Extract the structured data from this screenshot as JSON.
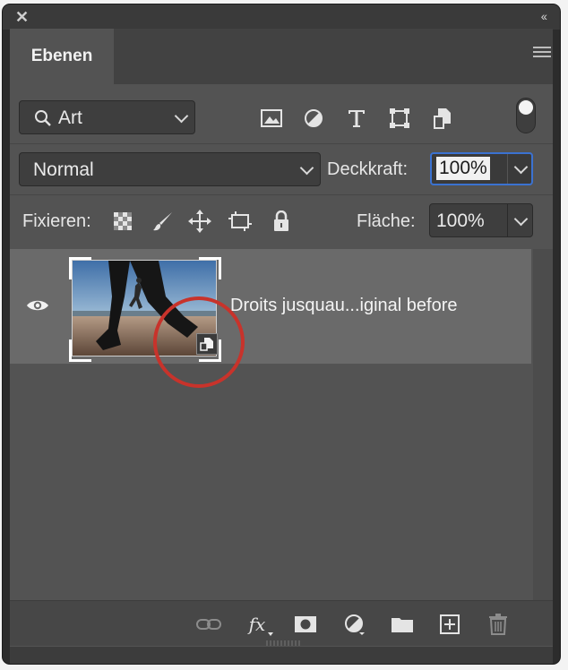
{
  "window": {
    "collapse_glyph": "‹‹"
  },
  "panel": {
    "tab_title": "Ebenen"
  },
  "filter": {
    "label": "Art",
    "icons": [
      "image-filter-icon",
      "adjustment-filter-icon",
      "type-filter-icon",
      "shape-filter-icon",
      "smart-object-filter-icon"
    ]
  },
  "blend": {
    "mode": "Normal",
    "opacity_label": "Deckkraft:",
    "opacity_value": "100%"
  },
  "lock": {
    "label": "Fixieren:",
    "icons": [
      "lock-transparency-icon",
      "lock-image-icon",
      "lock-position-icon",
      "lock-artboard-icon",
      "lock-all-icon"
    ],
    "fill_label": "Fläche:",
    "fill_value": "100%"
  },
  "layers": [
    {
      "name": "Droits jusquau...iginal before",
      "visible": true,
      "type": "smart-object",
      "selected": true
    }
  ],
  "footer": {
    "icons": [
      "link-layers-icon",
      "fx-icon",
      "add-mask-icon",
      "adjustment-layer-icon",
      "new-group-icon",
      "new-layer-icon",
      "delete-layer-icon"
    ],
    "fx_text": "fx"
  },
  "colors": {
    "highlight_circle": "#c8332b",
    "focus_border": "#3b72d1",
    "panel_bg": "#535353"
  }
}
